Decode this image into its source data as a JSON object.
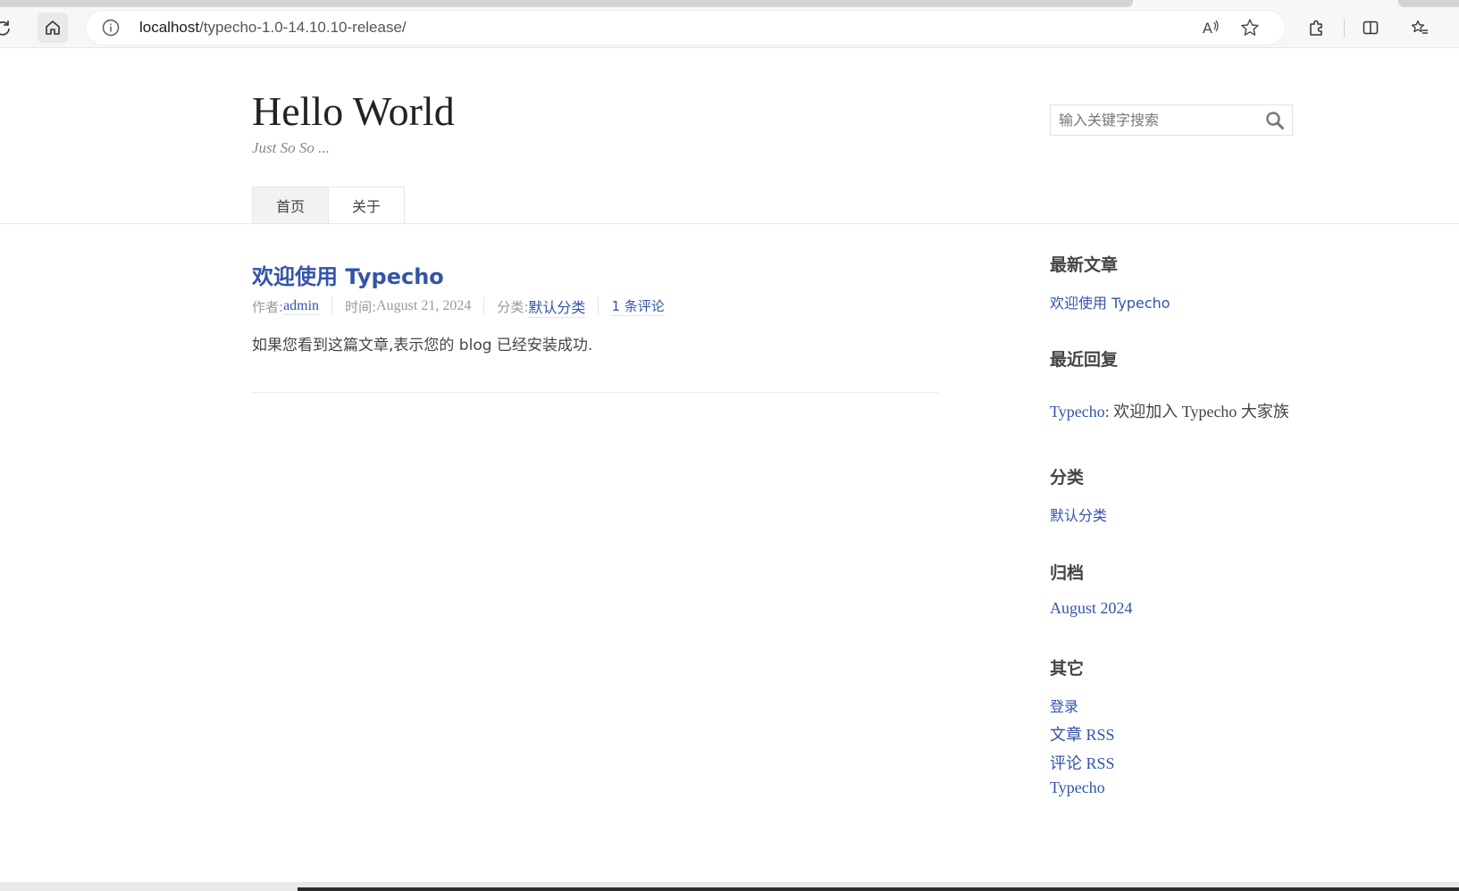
{
  "browser": {
    "url_host": "localhost",
    "url_path": "/typecho-1.0-14.10.10-release/",
    "icons": [
      "reload-icon",
      "home-icon",
      "info-icon",
      "read-aloud-icon",
      "favorite-star-icon",
      "extensions-icon",
      "split-screen-icon",
      "favorites-list-icon"
    ]
  },
  "site": {
    "title": "Hello World",
    "description": "Just So So ..."
  },
  "search": {
    "placeholder": "输入关键字搜索",
    "value": ""
  },
  "nav": {
    "items": [
      {
        "label": "首页",
        "current": true
      },
      {
        "label": "关于",
        "current": false
      }
    ]
  },
  "post": {
    "title": "欢迎使用 Typecho",
    "meta": {
      "author_label": "作者:",
      "author": "admin",
      "time_label": "时间:",
      "time": "August 21, 2024",
      "category_label": "分类:",
      "category": "默认分类",
      "comments": "1 条评论"
    },
    "content": "如果您看到这篇文章,表示您的 blog 已经安装成功."
  },
  "sidebar": {
    "recent_posts": {
      "title": "最新文章",
      "items": [
        "欢迎使用 Typecho"
      ]
    },
    "recent_comments": {
      "title": "最近回复",
      "items": [
        {
          "author": "Typecho",
          "text": ": 欢迎加入 Typecho 大家族"
        }
      ]
    },
    "categories": {
      "title": "分类",
      "items": [
        "默认分类"
      ]
    },
    "archives": {
      "title": "归档",
      "items": [
        "August 2024"
      ]
    },
    "misc": {
      "title": "其它",
      "items": [
        "登录",
        "文章 RSS",
        "评论 RSS",
        "Typecho"
      ]
    }
  },
  "colors": {
    "link": "#3354aa",
    "text": "#444444",
    "muted": "#999999"
  }
}
